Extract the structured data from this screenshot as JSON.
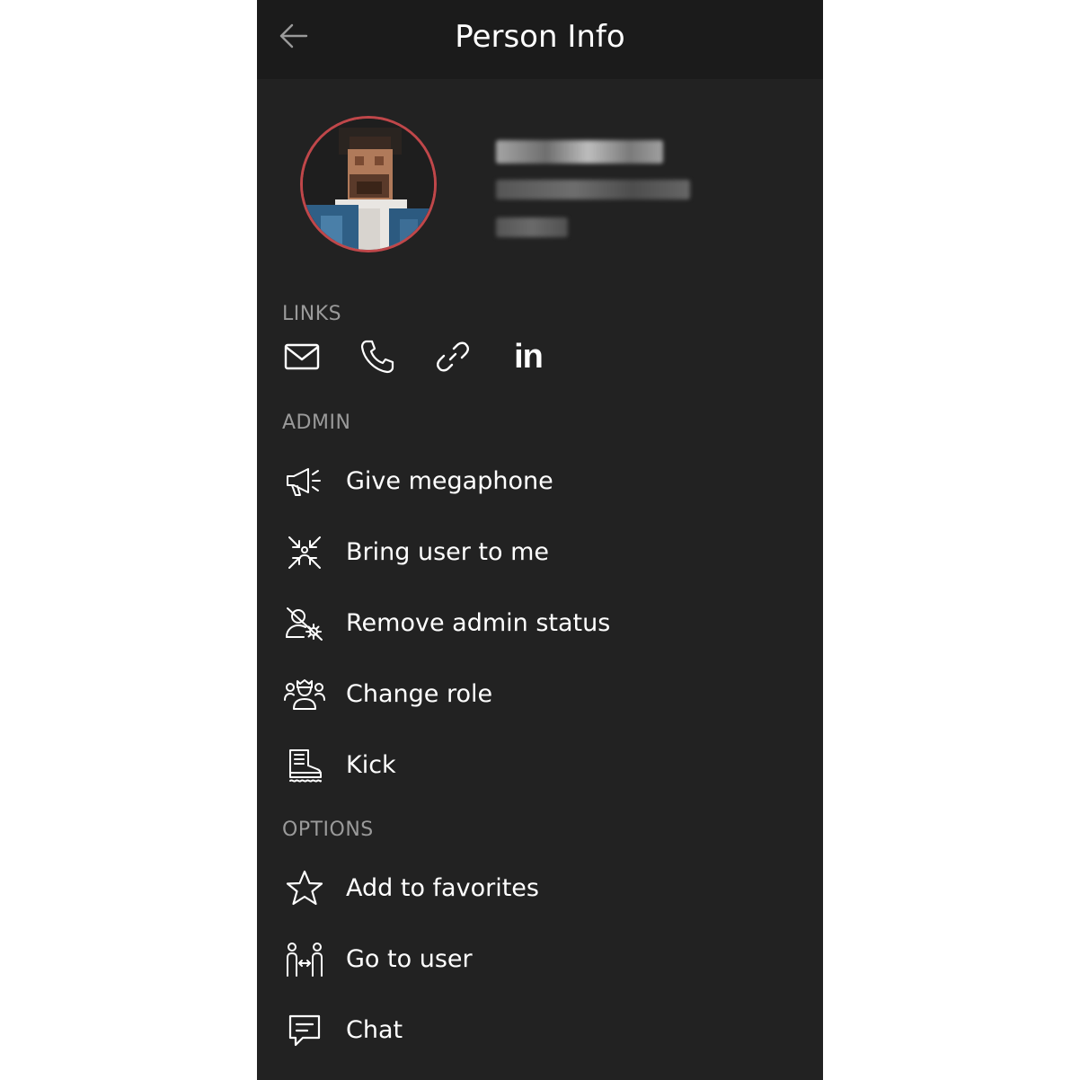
{
  "header": {
    "title": "Person Info",
    "back_icon": "arrow-left-icon"
  },
  "profile": {
    "avatar_icon": "avatar",
    "accent_color": "#c0474a"
  },
  "links": {
    "section_label": "LINKS",
    "items": [
      {
        "icon": "mail-icon"
      },
      {
        "icon": "phone-icon"
      },
      {
        "icon": "link-icon"
      },
      {
        "icon": "linkedin-icon",
        "text": "in"
      }
    ]
  },
  "admin": {
    "section_label": "ADMIN",
    "items": [
      {
        "label": "Give megaphone",
        "icon": "megaphone-icon"
      },
      {
        "label": "Bring user to me",
        "icon": "bring-user-icon"
      },
      {
        "label": "Remove admin status",
        "icon": "remove-admin-icon"
      },
      {
        "label": "Change role",
        "icon": "change-role-icon"
      },
      {
        "label": "Kick",
        "icon": "boot-icon"
      }
    ]
  },
  "options": {
    "section_label": "OPTIONS",
    "items": [
      {
        "label": "Add to favorites",
        "icon": "star-icon"
      },
      {
        "label": "Go to user",
        "icon": "go-to-user-icon"
      },
      {
        "label": "Chat",
        "icon": "chat-icon"
      }
    ]
  },
  "colors": {
    "panel_bg": "#222222",
    "header_bg": "#1b1b1b",
    "section_label": "#9a9a9a",
    "text": "#ffffff"
  }
}
